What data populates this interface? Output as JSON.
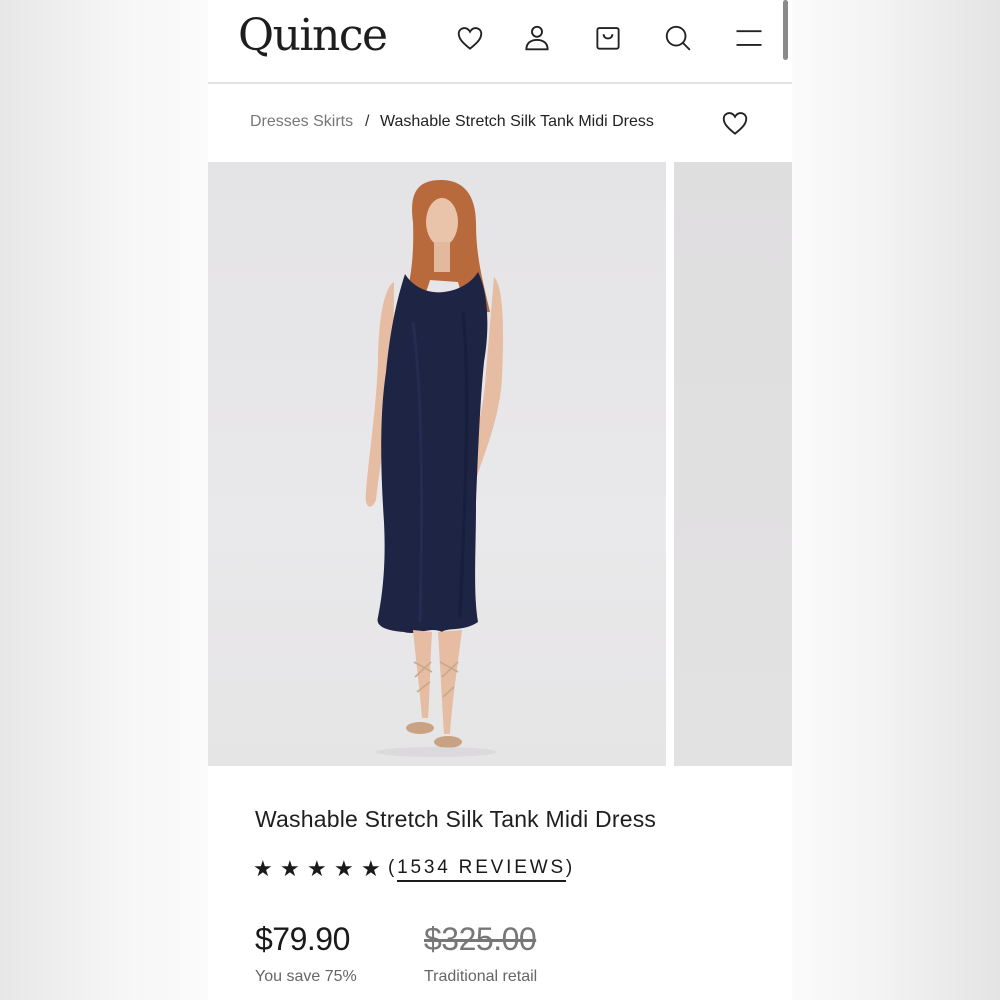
{
  "header": {
    "logo": "Quince",
    "icons": [
      "heart-icon",
      "user-icon",
      "bag-icon",
      "search-icon",
      "menu-icon"
    ]
  },
  "breadcrumb": {
    "parent": "Dresses Skirts",
    "separator": "/",
    "current": "Washable Stretch Silk Tank Midi Dress"
  },
  "gallery": {
    "images": [
      "product-photo-front",
      "product-photo-next"
    ],
    "dress_color": "#1d2444"
  },
  "product": {
    "title": "Washable Stretch Silk Tank Midi Dress",
    "rating_stars": 5,
    "reviews_label": "(1534 REVIEWS)",
    "reviews_open": "(",
    "reviews_text": "1534 REVIEWS",
    "reviews_close": ")",
    "price": "$79.90",
    "savings": "You save 75%",
    "retail_price": "$325.00",
    "retail_label": "Traditional retail"
  }
}
